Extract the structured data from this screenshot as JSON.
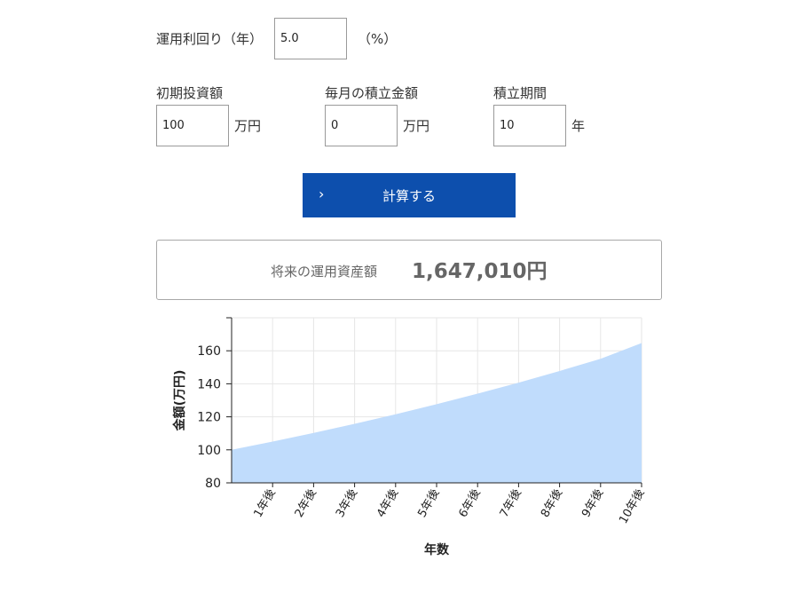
{
  "form": {
    "yield": {
      "label": "運用利回り（年）",
      "value": "5.0",
      "unit": "（%）"
    },
    "initial": {
      "label": "初期投資額",
      "value": "100",
      "unit": "万円"
    },
    "monthly": {
      "label": "毎月の積立金額",
      "value": "0",
      "unit": "万円"
    },
    "period": {
      "label": "積立期間",
      "value": "10",
      "unit": "年"
    }
  },
  "button": {
    "label": "計算する",
    "icon": "chevron-right-icon"
  },
  "result": {
    "label": "将来の運用資産額",
    "value": "1,647,010円"
  },
  "chart_data": {
    "type": "area",
    "categories": [
      "",
      "1年後",
      "2年後",
      "3年後",
      "4年後",
      "5年後",
      "6年後",
      "7年後",
      "8年後",
      "9年後",
      "10年後"
    ],
    "values": [
      100,
      105,
      110.25,
      115.76,
      121.55,
      127.63,
      134.01,
      140.71,
      147.75,
      155.13,
      164.7
    ],
    "xlabel": "年数",
    "ylabel": "金額(万円)",
    "ylim": [
      80,
      180
    ],
    "yticks": [
      80,
      100,
      120,
      140,
      160
    ],
    "grid": true,
    "colors": {
      "fill": "#c0dcfc",
      "grid": "#e6e6e6",
      "axis": "#222222"
    }
  }
}
